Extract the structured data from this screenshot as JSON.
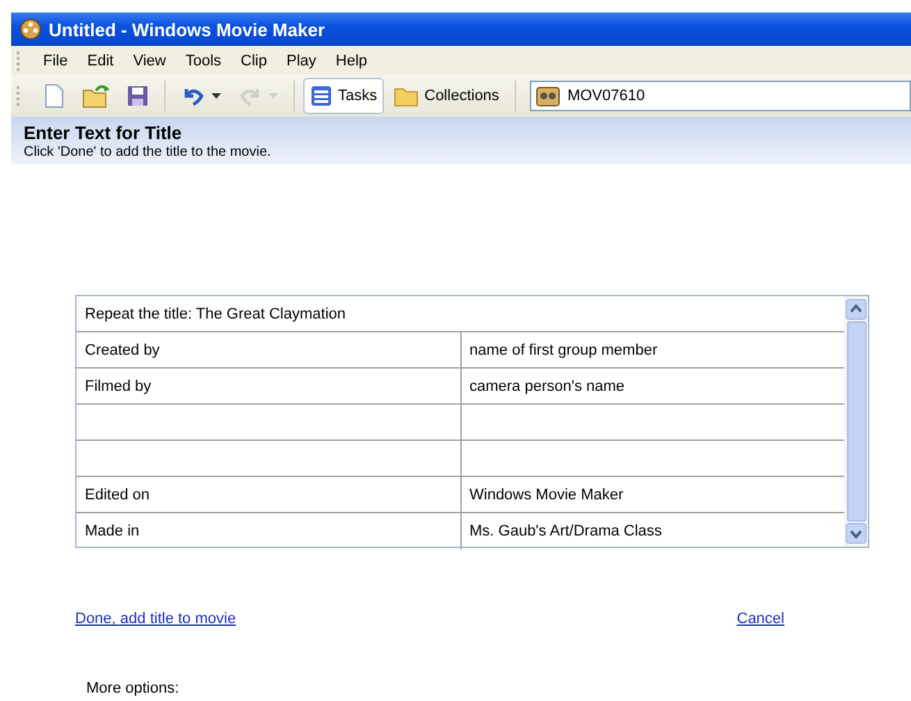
{
  "window": {
    "title": "Untitled - Windows Movie Maker"
  },
  "menu": [
    "File",
    "Edit",
    "View",
    "Tools",
    "Clip",
    "Play",
    "Help"
  ],
  "toolbar": [
    {
      "kind": "new",
      "selected": false,
      "disabled": false
    },
    {
      "kind": "open",
      "selected": false,
      "disabled": false
    },
    {
      "kind": "save",
      "selected": false,
      "disabled": false
    },
    {
      "kind": "undo",
      "selected": false,
      "disabled": false
    },
    {
      "kind": "redo",
      "selected": false,
      "disabled": true
    },
    {
      "kind": "tasks",
      "label": "Tasks",
      "selected": true,
      "disabled": false
    },
    {
      "kind": "collections",
      "label": "Collections",
      "selected": false,
      "disabled": false
    }
  ],
  "collection_field": {
    "value": "MOV07610"
  },
  "header": {
    "title": "Enter Text for Title",
    "subtitle": "Click 'Done' to add the title to the movie."
  },
  "title_table": {
    "first_line": "Repeat the title: The Great Claymation",
    "rows": [
      {
        "column_1": "Created by",
        "column_2": "name of first group member"
      },
      {
        "column_1": "Filmed by",
        "column_2": "camera person's name"
      },
      {},
      {},
      {
        "column_1": "Edited on",
        "column_2": "Windows Movie Maker"
      },
      {
        "column_1": "Made in",
        "column_2": "Ms. Gaub's Art/Drama Class"
      }
    ]
  },
  "links": {
    "done": "Done, add title to movie",
    "cancel": "Cancel"
  },
  "more_options": "More options:"
}
